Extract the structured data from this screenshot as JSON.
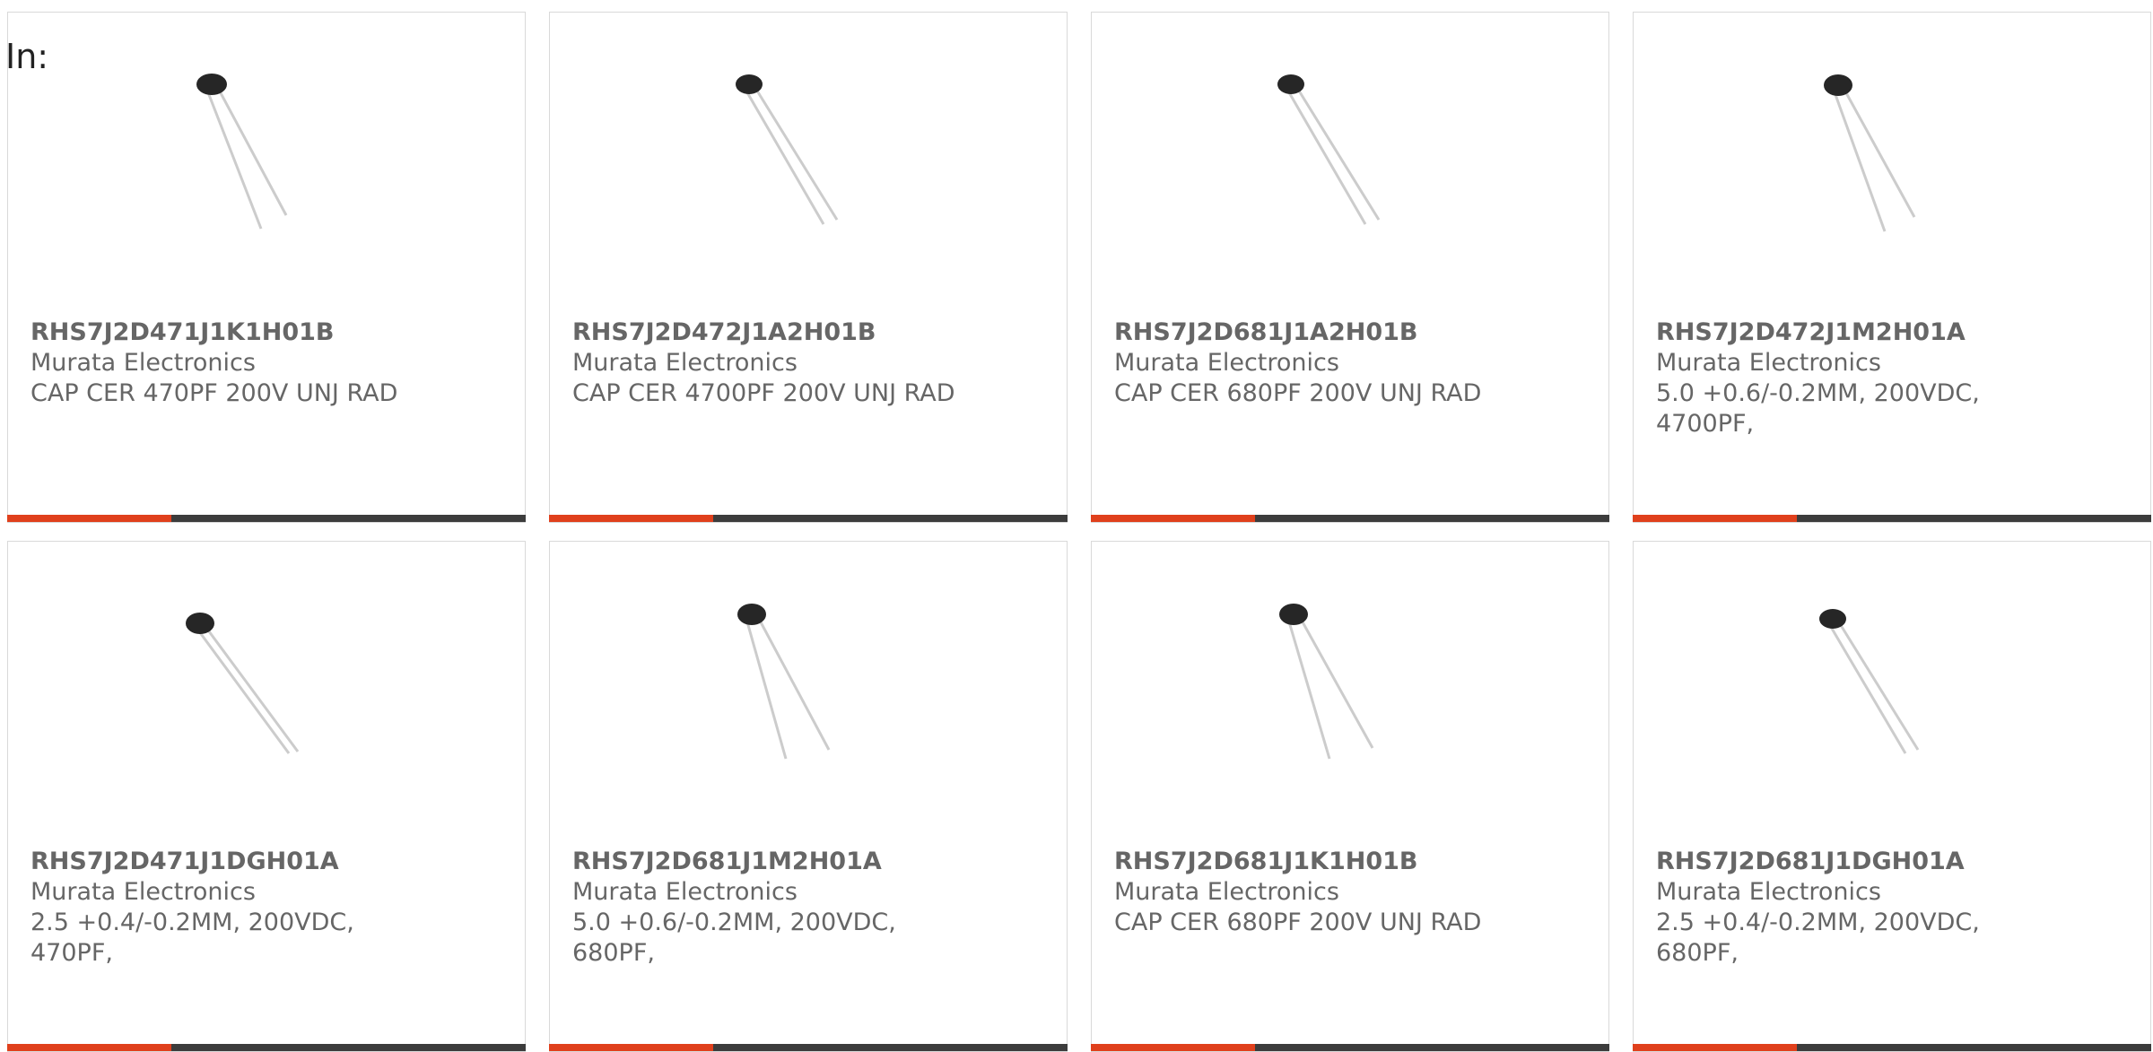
{
  "page": {
    "in_label": "In:"
  },
  "colors": {
    "accent": "#e0401c",
    "bar": "#3c3c3c",
    "text": "#666666",
    "border": "#d9d9d9",
    "capacitor_body": "#262626",
    "lead": "#cccccc"
  },
  "products": [
    {
      "part": "RHS7J2D471J1K1H01B",
      "manufacturer": "Murata Electronics",
      "description": "CAP CER 470PF 200V UNJ RAD",
      "image_icon": "radial-ceramic-capacitor-icon"
    },
    {
      "part": "RHS7J2D472J1A2H01B",
      "manufacturer": "Murata Electronics",
      "description": "CAP CER 4700PF 200V UNJ RAD",
      "image_icon": "radial-ceramic-capacitor-icon"
    },
    {
      "part": "RHS7J2D681J1A2H01B",
      "manufacturer": "Murata Electronics",
      "description": "CAP CER 680PF 200V UNJ RAD",
      "image_icon": "radial-ceramic-capacitor-icon"
    },
    {
      "part": "RHS7J2D472J1M2H01A",
      "manufacturer": "Murata Electronics",
      "description": "5.0 +0.6/-0.2MM, 200VDC,\n4700PF,",
      "image_icon": "radial-ceramic-capacitor-icon"
    },
    {
      "part": "RHS7J2D471J1DGH01A",
      "manufacturer": "Murata Electronics",
      "description": "2.5 +0.4/-0.2MM, 200VDC,\n470PF,",
      "image_icon": "radial-ceramic-capacitor-icon"
    },
    {
      "part": "RHS7J2D681J1M2H01A",
      "manufacturer": "Murata Electronics",
      "description": "5.0 +0.6/-0.2MM, 200VDC,\n680PF,",
      "image_icon": "radial-ceramic-capacitor-icon"
    },
    {
      "part": "RHS7J2D681J1K1H01B",
      "manufacturer": "Murata Electronics",
      "description": "CAP CER 680PF 200V UNJ RAD",
      "image_icon": "radial-ceramic-capacitor-icon"
    },
    {
      "part": "RHS7J2D681J1DGH01A",
      "manufacturer": "Murata Electronics",
      "description": "2.5 +0.4/-0.2MM, 200VDC,\n680PF,",
      "image_icon": "radial-ceramic-capacitor-icon"
    }
  ]
}
